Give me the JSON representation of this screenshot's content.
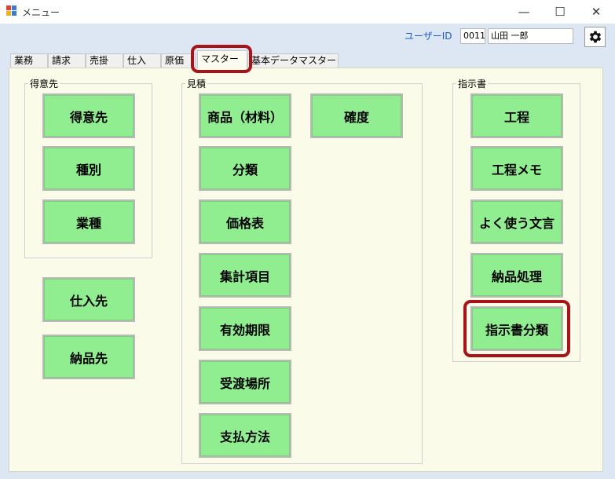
{
  "window": {
    "title": "メニュー",
    "minimize": "—",
    "maximize": "☐",
    "close": "✕"
  },
  "header": {
    "user_id_label": "ユーザーID",
    "user_code": "0011",
    "user_name": "山田 一郎"
  },
  "tabs": [
    {
      "label": "業務"
    },
    {
      "label": "請求"
    },
    {
      "label": "売掛"
    },
    {
      "label": "仕入"
    },
    {
      "label": "原価"
    },
    {
      "label": "マスター"
    },
    {
      "label": "基本データマスター"
    }
  ],
  "groups": {
    "customer": {
      "title": "得意先",
      "buttons": [
        "得意先",
        "種別",
        "業種"
      ]
    },
    "standalone": {
      "buttons": [
        "仕入先",
        "納品先"
      ]
    },
    "estimate": {
      "title": "見積",
      "buttons": [
        "商品（材料）",
        "分類",
        "価格表",
        "集計項目",
        "有効期限",
        "受渡場所",
        "支払方法",
        "確度"
      ]
    },
    "instruction": {
      "title": "指示書",
      "buttons": [
        "工程",
        "工程メモ",
        "よく使う文言",
        "納品処理",
        "指示書分類"
      ]
    }
  },
  "colors": {
    "button_green": "#90ee90",
    "highlight_red": "#a8131a",
    "panel_bg": "#fbfbe9",
    "client_bg": "#dde7f3"
  },
  "icons": {
    "settings": "gear-icon",
    "app": "app-icon"
  }
}
